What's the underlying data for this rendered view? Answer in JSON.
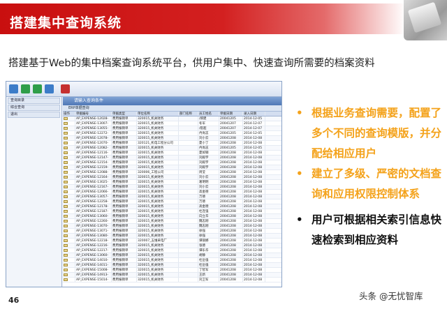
{
  "slide": {
    "title": "搭建集中查询系统",
    "subtitle": "搭建基于Web的集中档案查询系统平台，供用户集中、快速查询所需要的档案资料",
    "page_number": "46",
    "watermark": "头条 @无忧智库",
    "colors": {
      "banner": "#c90f0f",
      "bullet_accent": "#f4a21a",
      "text": "#111111"
    }
  },
  "app": {
    "sidebar": [
      "查询目录",
      "综合查询",
      "退出"
    ],
    "query_bar": "请输入查询条件",
    "system_bar": "ERP单据查询",
    "columns": [
      "操作",
      "单据编号",
      "单据类型",
      "单位名称",
      "部门名称",
      "员工姓名",
      "单据日期",
      "录入日期"
    ],
    "rows": [
      [
        "AP_EXPENSE-12028-",
        "费用报销单",
        "320015_机关财务",
        "",
        "/郑建",
        "20041205",
        "2014-12-05"
      ],
      [
        "AP_EXPENSE-13007-",
        "费用报销单",
        "320015_机关财务",
        "",
        "冬军",
        "20041207",
        "2014-12-07"
      ],
      [
        "AP_EXPENSE-13055-",
        "费用报销单",
        "320015_机关财务",
        "",
        "/崔超",
        "20041207",
        "2014-12-07"
      ],
      [
        "AP_EXPENSE-12272-",
        "费用报销单",
        "320015_机关财务",
        "",
        "冉尚志",
        "20041205",
        "2014-12-05"
      ],
      [
        "AP_EXPENSE-12078-",
        "费用报销单",
        "320015_机关财务",
        "",
        "刘小云",
        "20041208",
        "2014-12-08"
      ],
      [
        "AP_EXPENSE-12070-",
        "费用报销单",
        "320121_机电工程分公司",
        "",
        "夏小丁",
        "20041208",
        "2014-12-08"
      ],
      [
        "AP_EXPENSE-12082-",
        "费用报销单",
        "320015_机关财务",
        "",
        "冉尚志",
        "20041205",
        "2014-12-05"
      ],
      [
        "AP_EXPENSE-12116-",
        "费用报销单",
        "320015_机关财务",
        "",
        "夏如钢",
        "20041208",
        "2014-12-08"
      ],
      [
        "AP_EXPENSE-12147-",
        "费用报销单",
        "320015_机关财务",
        "",
        "刘殿宇",
        "20041208",
        "2014-12-08"
      ],
      [
        "AP_EXPENSE-12154-",
        "费用报销单",
        "320015_机关财务",
        "",
        "刘殿宇",
        "20041208",
        "2014-12-08"
      ],
      [
        "AP_EXPENSE-12159-",
        "费用报销单",
        "320015_机关财务",
        "",
        "刘殿宇",
        "20041208",
        "2014-12-08"
      ],
      [
        "AP_EXPENSE-12088-",
        "费用报销单",
        "320006_工程公司",
        "",
        "周莹",
        "20041208",
        "2014-12-08"
      ],
      [
        "AP_EXPENSE-12164-",
        "费用报销单",
        "320015_机关财务",
        "",
        "刘小云",
        "20041208",
        "2014-12-08"
      ],
      [
        "AP_EXPENSE-13025-",
        "费用报销单",
        "320015_机关财务",
        "",
        "葛明明",
        "20041208",
        "2014-12-08"
      ],
      [
        "AP_EXPENSE-12167-",
        "费用报销单",
        "320015_机关财务",
        "",
        "刘小云",
        "20041208",
        "2014-12-08"
      ],
      [
        "AP_EXPENSE-12066-",
        "费用报销单",
        "320015_机关财务",
        "",
        "高金德",
        "20041208",
        "2014-12-08"
      ],
      [
        "AP_EXPENSE-13057-",
        "费用报销单",
        "320015_机关财务",
        "",
        "万德",
        "20041208",
        "2014-12-08"
      ],
      [
        "AP_EXPENSE-12258-",
        "费用报销单",
        "320015_机关财务",
        "",
        "万德",
        "20041208",
        "2014-12-08"
      ],
      [
        "AP_EXPENSE-12178-",
        "费用报销单",
        "320015_机关财务",
        "",
        "高金德",
        "20041208",
        "2014-12-08"
      ],
      [
        "AP_EXPENSE-12187-",
        "费用报销单",
        "320015_机关财务",
        "",
        "杜连强",
        "20041208",
        "2014-12-08"
      ],
      [
        "AP_EXPENSE-13060-",
        "费用报销单",
        "320015_机关财务",
        "",
        "向立华",
        "20041208",
        "2014-12-08"
      ],
      [
        "AP_EXPENSE-12260-",
        "费用报销单",
        "320015_机关财务",
        "",
        "魏志刚",
        "20041208",
        "2014-12-08"
      ],
      [
        "AP_EXPENSE-13070-",
        "费用报销单",
        "320015_机关财务",
        "",
        "魏志刚",
        "20041208",
        "2014-12-08"
      ],
      [
        "AP_EXPENSE-13071-",
        "费用报销单",
        "320015_机关财务",
        "",
        "徐强",
        "20041208",
        "2014-12-08"
      ],
      [
        "AP_EXPENSE-13080-",
        "费用报销单",
        "320015_机关财务",
        "",
        "徐强",
        "20041208",
        "2014-12-08"
      ],
      [
        "AP_EXPENSE-12218-",
        "费用报销单",
        "320007_五维采电厂",
        "",
        "谭丽娜",
        "20041208",
        "2014-12-08"
      ],
      [
        "AP_EXPENSE-12216-",
        "费用报销单",
        "320015_机关财务",
        "",
        "张德",
        "20041208",
        "2014-12-08"
      ],
      [
        "AP_EXPENSE-12217-",
        "费用报销单",
        "320015_机关财务",
        "",
        "谭乐华",
        "20041208",
        "2014-12-08"
      ],
      [
        "AP_EXPENSE-13060-",
        "费用报销单",
        "320015_机关财务",
        "",
        "胡静",
        "20041208",
        "2014-12-08"
      ],
      [
        "AP_EXPENSE-14010-",
        "费用报销单",
        "320015_机关财务",
        "",
        "杜岳强",
        "20041208",
        "2014-12-08"
      ],
      [
        "AP_EXPENSE-14011-",
        "费用报销单",
        "320015_机关财务",
        "",
        "杜岳强",
        "20041208",
        "2014-12-08"
      ],
      [
        "AP_EXPENSE-15008-",
        "费用报销单",
        "320015_机关财务",
        "",
        "丁智军",
        "20041208",
        "2014-12-08"
      ],
      [
        "AP_EXPENSE-14913-",
        "费用报销单",
        "320015_机关财务",
        "",
        "王新",
        "20041208",
        "2014-12-08"
      ],
      [
        "AP_EXPENSE-15014-",
        "费用报销单",
        "320015_机关财务",
        "",
        "刘卫军",
        "20041208",
        "2014-12-08"
      ]
    ]
  },
  "bullets": [
    {
      "text": "根据业务查询需要，配置了多个不同的查询模版，并分配给相应用户",
      "color": "orange"
    },
    {
      "text": "建立了多级、严密的文档查询和应用权限控制体系",
      "color": "orange"
    },
    {
      "text": "用户可根据相关索引信息快速检索到相应资料",
      "color": "black"
    }
  ]
}
